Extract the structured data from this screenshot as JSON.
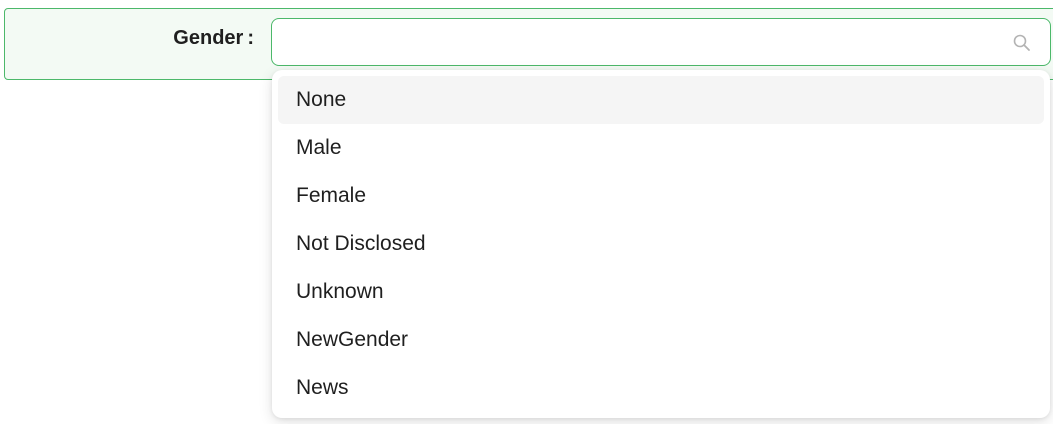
{
  "form": {
    "gender_label": "Gender",
    "gender_colon": ":"
  },
  "select": {
    "value": "",
    "placeholder": "",
    "icon": "search-icon"
  },
  "dropdown": {
    "options": [
      {
        "label": "None",
        "active": true
      },
      {
        "label": "Male",
        "active": false
      },
      {
        "label": "Female",
        "active": false
      },
      {
        "label": "Not Disclosed",
        "active": false
      },
      {
        "label": "Unknown",
        "active": false
      },
      {
        "label": "NewGender",
        "active": false
      },
      {
        "label": "News",
        "active": false
      }
    ]
  },
  "colors": {
    "accent": "#4cb86a",
    "row_background": "#f3faf4",
    "active_option_background": "#f5f5f5"
  }
}
